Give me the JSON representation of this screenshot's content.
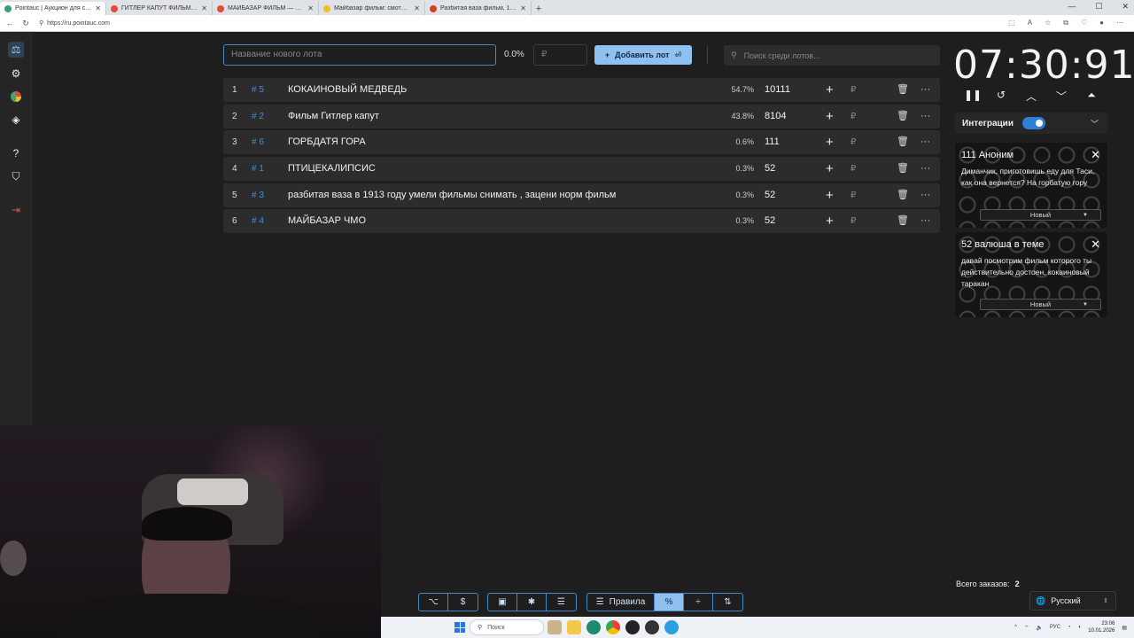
{
  "browser": {
    "tabs": [
      {
        "title": "Pointauc | Аукцион для стримера",
        "active": true,
        "color": "#3aa06f"
      },
      {
        "title": "ГИТЛЕР КАПУТ ФИЛЬМ — Яндекс",
        "active": false,
        "color": "#e24a3b"
      },
      {
        "title": "МАЙБАЗАР ФИЛЬМ — Яндекс",
        "active": false,
        "color": "#e24a3b"
      },
      {
        "title": "Майбазар фильм: смотрите и со",
        "active": false,
        "color": "#f0c020"
      },
      {
        "title": "Разбитая ваза фильм, 1913, дата",
        "active": false,
        "color": "#d24020"
      }
    ],
    "url": "https://ru.pointauc.com"
  },
  "sidebar": {
    "icons": [
      "gavel-icon",
      "settings-icon",
      "pie-chart-icon",
      "layers-icon",
      "help-icon",
      "shield-icon",
      "logout-icon"
    ]
  },
  "controls": {
    "lot_placeholder": "Название нового лота",
    "percent": "0.0%",
    "rub_placeholder": "₽",
    "add_label": "Добавить лот",
    "search_placeholder": "Поиск среди лотов..."
  },
  "lots": [
    {
      "index": "1",
      "id": "# 5",
      "name": "КОКАИНОВЫЙ МЕДВЕДЬ",
      "percent": "54.7%",
      "amount": "10111"
    },
    {
      "index": "2",
      "id": "# 2",
      "name": "Фильм Гитлер капут",
      "percent": "43.8%",
      "amount": "8104"
    },
    {
      "index": "3",
      "id": "# 6",
      "name": "ГОРБДАТЯ ГОРА",
      "percent": "0.6%",
      "amount": "111"
    },
    {
      "index": "4",
      "id": "# 1",
      "name": "ПТИЦЕКАЛИПСИС",
      "percent": "0.3%",
      "amount": "52"
    },
    {
      "index": "5",
      "id": "# 3",
      "name": "разбитая ваза в 1913 году умели фильмы снимать , зацени норм фильм",
      "percent": "0.3%",
      "amount": "52"
    },
    {
      "index": "6",
      "id": "# 4",
      "name": "МАЙБАЗАР ЧМО",
      "percent": "0.3%",
      "amount": "52"
    }
  ],
  "row_icons": {
    "plus": "+",
    "rub": "₽",
    "delete": "🗑",
    "more": "···"
  },
  "timer": {
    "value": "07:30:91"
  },
  "integrations": {
    "label": "Интеграции",
    "enabled": true
  },
  "donations": [
    {
      "header": "111 Аноним",
      "message": "Диманчик, приготовишь еду для Таси, как она вернется? На горбатую гору",
      "status": "Новый"
    },
    {
      "header": "52 валюша в теме",
      "message": "давай посмотрим фильм которого ты действительно достоен, кокаиновый таракан",
      "status": "Новый"
    }
  ],
  "orders": {
    "label": "Всего заказов:",
    "count": "2"
  },
  "language": {
    "value": "Русский"
  },
  "bottom_toolbar": {
    "rules_label": "Правила"
  },
  "taskbar": {
    "search_placeholder": "Поиск",
    "lang": "РУС",
    "time": "23:06",
    "date": "10.01.2026"
  }
}
